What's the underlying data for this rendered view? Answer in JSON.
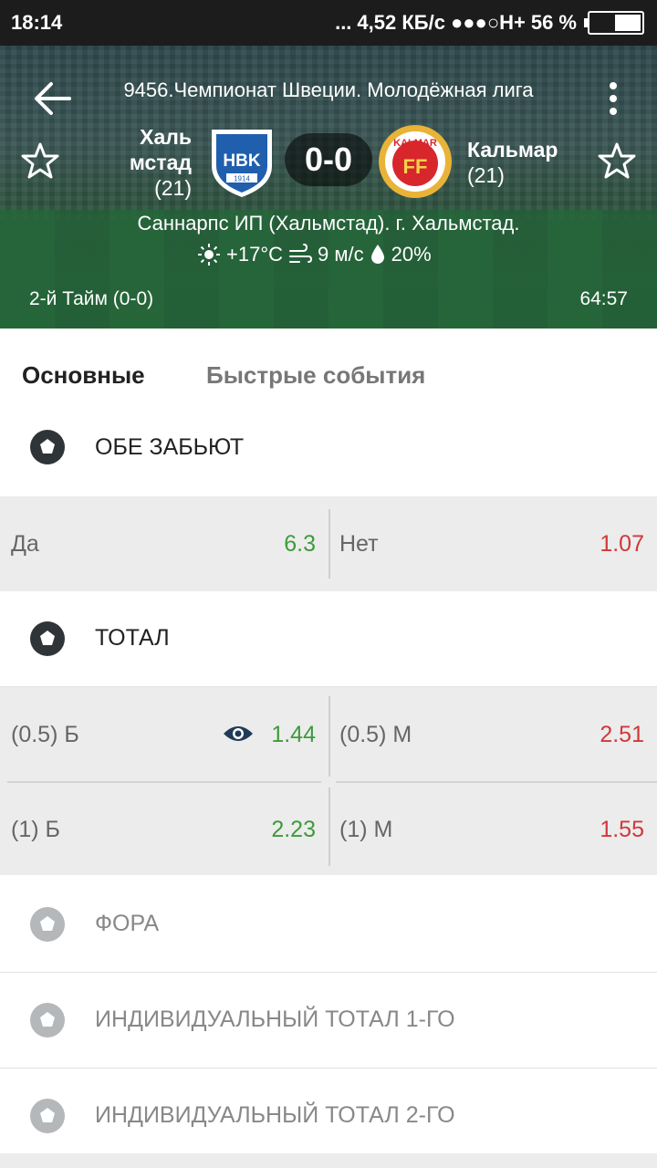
{
  "status_bar": {
    "time": "18:14",
    "dots": "...",
    "speed": "4,52 КБ/с",
    "signal": "●●●○H+",
    "battery": "56 %",
    "battery_level": 0.56
  },
  "header": {
    "league": "9456.Чемпионат Швеции. Молодёжная лига",
    "team1": {
      "name_line1": "Халь",
      "name_line2": "мстад",
      "rank": "(21)",
      "logo_text": "HBK",
      "logo_year": "1914"
    },
    "team2": {
      "name": "Кальмар",
      "rank": "(21)",
      "logo_text": "KALMAR",
      "logo_letters": "FF"
    },
    "score": "0-0",
    "stadium": "Саннарпс ИП (Хальмстад). г. Хальмстад.",
    "weather": {
      "temp": "+17°C",
      "wind": "9 м/с",
      "humidity": "20%"
    },
    "period": "2-й  Тайм (0-0)",
    "clock": "64:57"
  },
  "tabs": [
    {
      "label": "Основные",
      "active": true
    },
    {
      "label": "Быстрые события",
      "active": false
    }
  ],
  "markets": {
    "both_score": {
      "title": "ОБЕ ЗАБЬЮТ",
      "yes": {
        "label": "Да",
        "value": "6.3"
      },
      "no": {
        "label": "Нет",
        "value": "1.07"
      }
    },
    "total": {
      "title": "ТОТАЛ",
      "rows": [
        {
          "over_label": "(0.5) Б",
          "over_value": "1.44",
          "under_label": "(0.5) М",
          "under_value": "2.51"
        },
        {
          "over_label": "(1) Б",
          "over_value": "2.23",
          "under_label": "(1) М",
          "under_value": "1.55"
        }
      ]
    },
    "handicap": {
      "title": "ФОРА"
    },
    "ind_total_1": {
      "title": "ИНДИВИДУАЛЬНЫЙ ТОТАЛ 1-ГО"
    },
    "ind_total_2": {
      "title": "ИНДИВИДУАЛЬНЫЙ ТОТАЛ 2-ГО"
    }
  },
  "colors": {
    "odd_green": "#3f9a3a",
    "odd_red": "#d0383b",
    "odds_bg": "#ececec",
    "status_bg": "#1c1c1c"
  },
  "icons": [
    "back-arrow-icon",
    "more-vert-icon",
    "star-outline-icon",
    "sun-icon",
    "wind-icon",
    "drop-icon",
    "soccer-ball-icon",
    "eye-icon"
  ]
}
